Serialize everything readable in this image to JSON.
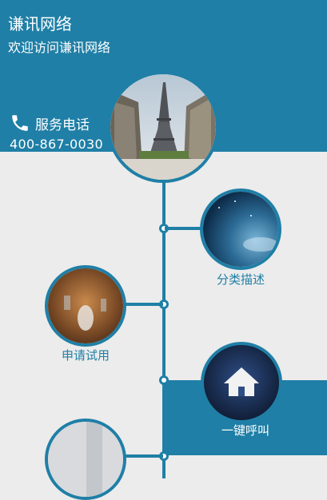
{
  "header": {
    "site_name": "谦讯网络",
    "welcome": "欢迎访问谦讯网络",
    "phone_label": "服务电话",
    "phone_number": "400-867-0030"
  },
  "timeline": {
    "items": [
      {
        "label": "分类描述",
        "image": "sky-nebula-image"
      },
      {
        "label": "申请试用",
        "image": "restaurant-image"
      },
      {
        "label": "一键呼叫",
        "icon": "home-icon"
      }
    ],
    "hero_image": "eiffel-tower-image"
  },
  "colors": {
    "primary": "#1f7fa6",
    "background": "#ececec"
  }
}
